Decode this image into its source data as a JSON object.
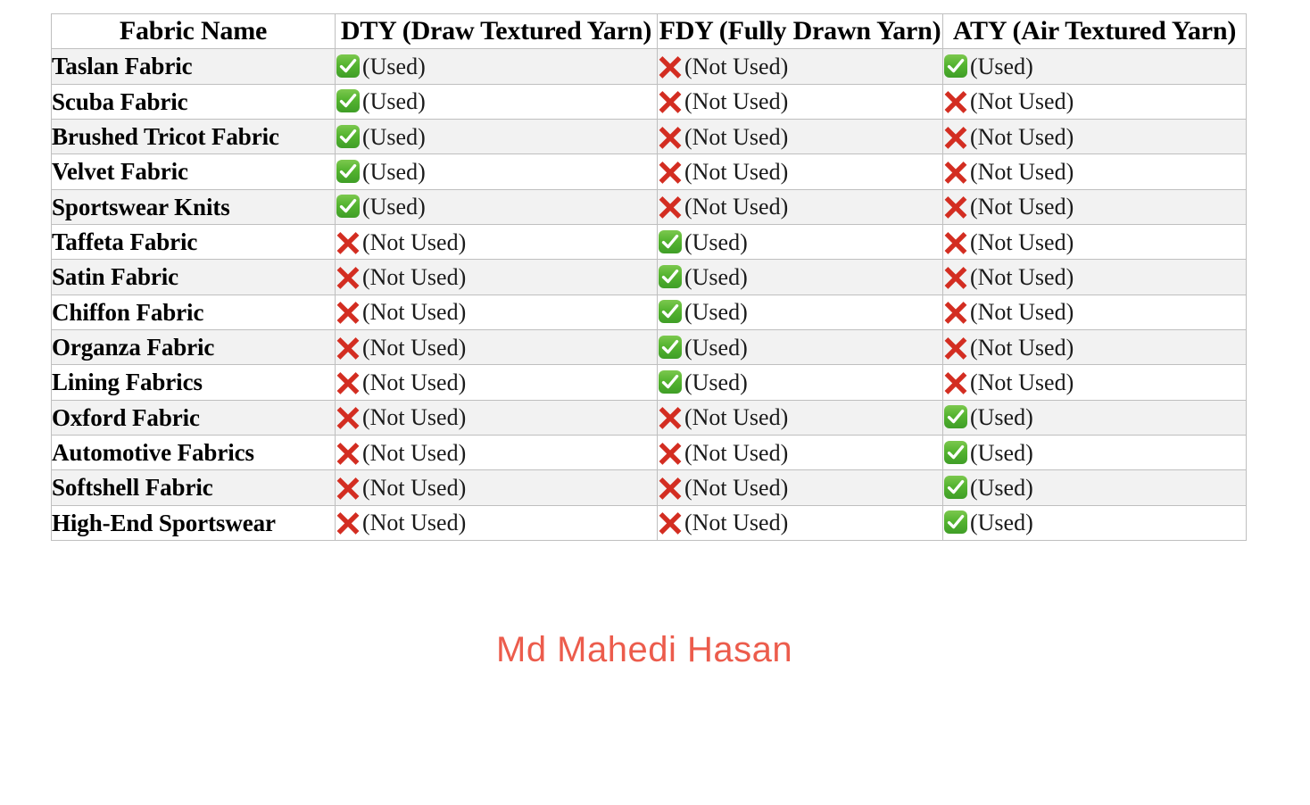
{
  "table": {
    "columns": [
      {
        "key": "fabric_name",
        "label": "Fabric Name"
      },
      {
        "key": "dty",
        "label": "DTY (Draw Textured Yarn)"
      },
      {
        "key": "fdy",
        "label": "FDY (Fully Drawn Yarn)"
      },
      {
        "key": "aty",
        "label": "ATY (Air Textured Yarn)"
      }
    ],
    "status_labels": {
      "used": "(Used)",
      "not_used": "(Not Used)"
    },
    "icons": {
      "used": "white-check-mark-icon",
      "not_used": "cross-mark-icon"
    },
    "colors": {
      "used_icon": "#4caf36",
      "not_used_icon": "#d32d21",
      "row_stripe": "#f2f2f2",
      "row_plain": "#ffffff",
      "border": "#bfbfbf",
      "watermark": "#ec5c4c"
    },
    "rows": [
      {
        "fabric_name": "Taslan Fabric",
        "dty": "used",
        "dty_label": "(Used)",
        "fdy": "not_used",
        "fdy_label": "(Not Used)",
        "aty": "used",
        "aty_label": "(Used)"
      },
      {
        "fabric_name": "Scuba Fabric",
        "dty": "used",
        "dty_label": "(Used)",
        "fdy": "not_used",
        "fdy_label": "(Not Used)",
        "aty": "not_used",
        "aty_label": "(Not Used)"
      },
      {
        "fabric_name": "Brushed Tricot Fabric",
        "dty": "used",
        "dty_label": "(Used)",
        "fdy": "not_used",
        "fdy_label": "(Not Used)",
        "aty": "not_used",
        "aty_label": "(Not Used)"
      },
      {
        "fabric_name": "Velvet Fabric",
        "dty": "used",
        "dty_label": "(Used)",
        "fdy": "not_used",
        "fdy_label": "(Not Used)",
        "aty": "not_used",
        "aty_label": "(Not Used)"
      },
      {
        "fabric_name": "Sportswear Knits",
        "dty": "used",
        "dty_label": "(Used)",
        "fdy": "not_used",
        "fdy_label": "(Not Used)",
        "aty": "not_used",
        "aty_label": "(Not Used)"
      },
      {
        "fabric_name": "Taffeta Fabric",
        "dty": "not_used",
        "dty_label": "(Not Used)",
        "fdy": "used",
        "fdy_label": "(Used)",
        "aty": "not_used",
        "aty_label": "(Not Used)"
      },
      {
        "fabric_name": "Satin Fabric",
        "dty": "not_used",
        "dty_label": "(Not Used)",
        "fdy": "used",
        "fdy_label": "(Used)",
        "aty": "not_used",
        "aty_label": "(Not Used)"
      },
      {
        "fabric_name": "Chiffon Fabric",
        "dty": "not_used",
        "dty_label": "(Not Used)",
        "fdy": "used",
        "fdy_label": "(Used)",
        "aty": "not_used",
        "aty_label": "(Not Used)"
      },
      {
        "fabric_name": "Organza Fabric",
        "dty": "not_used",
        "dty_label": "(Not Used)",
        "fdy": "used",
        "fdy_label": "(Used)",
        "aty": "not_used",
        "aty_label": "(Not Used)"
      },
      {
        "fabric_name": "Lining Fabrics",
        "dty": "not_used",
        "dty_label": "(Not Used)",
        "fdy": "used",
        "fdy_label": "(Used)",
        "aty": "not_used",
        "aty_label": "(Not Used)"
      },
      {
        "fabric_name": "Oxford Fabric",
        "dty": "not_used",
        "dty_label": "(Not Used)",
        "fdy": "not_used",
        "fdy_label": "(Not Used)",
        "aty": "used",
        "aty_label": "(Used)"
      },
      {
        "fabric_name": "Automotive Fabrics",
        "dty": "not_used",
        "dty_label": "(Not Used)",
        "fdy": "not_used",
        "fdy_label": "(Not Used)",
        "aty": "used",
        "aty_label": "(Used)"
      },
      {
        "fabric_name": "Softshell Fabric",
        "dty": "not_used",
        "dty_label": "(Not Used)",
        "fdy": "not_used",
        "fdy_label": "(Not Used)",
        "aty": "used",
        "aty_label": "(Used)"
      },
      {
        "fabric_name": "High-End Sportswear",
        "dty": "not_used",
        "dty_label": "(Not Used)",
        "fdy": "not_used",
        "fdy_label": "(Not Used)",
        "aty": "used",
        "aty_label": "(Used)"
      }
    ]
  },
  "watermark": {
    "text": "Md Mahedi Hasan"
  }
}
